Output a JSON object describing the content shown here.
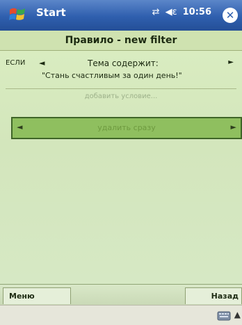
{
  "titlebar": {
    "title": "Start",
    "time": "10:56",
    "close": "✕"
  },
  "rule": {
    "header": "Правило - new filter"
  },
  "condition": {
    "if_label": "ЕСЛИ",
    "left_arrow": "◄",
    "line1": "Тема содержит:",
    "line2": "\"Стань счастливым за один день!\"",
    "right_arrow": "►"
  },
  "add_condition": "добавить условие...",
  "action": {
    "left_arrow": "◄",
    "label": "удалить сразу",
    "right_arrow": "►"
  },
  "toolbar": {
    "menu": "Меню",
    "back": "Назад"
  },
  "bottom": {
    "keyboard_arrow": "▲"
  }
}
